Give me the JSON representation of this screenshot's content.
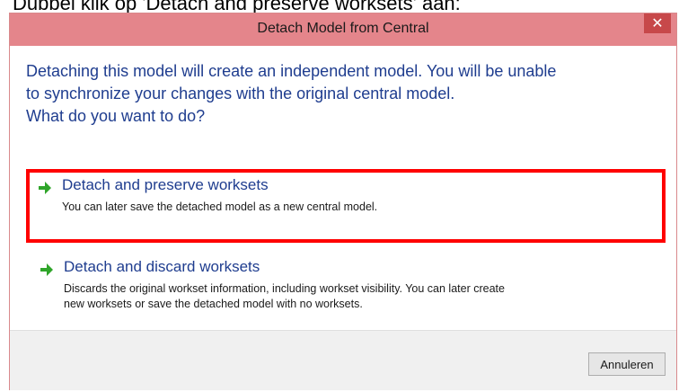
{
  "document": {
    "caption": "Dubbel klik op 'Detach and preserve worksets' aan:"
  },
  "dialog": {
    "title": "Detach Model from Central",
    "close_symbol": "✕",
    "message_lines": [
      "Detaching this model will create an independent model. You will be unable",
      "to synchronize your changes with the original central model.",
      "What do you want to do?"
    ],
    "options": [
      {
        "icon": "green-arrow-icon",
        "title": "Detach and preserve worksets",
        "description_lines": [
          "You can later save the detached model as a new central model."
        ],
        "highlighted": true
      },
      {
        "icon": "green-arrow-icon",
        "title": "Detach and discard worksets",
        "description_lines": [
          "Discards the original workset information, including workset visibility. You can later create",
          "new worksets or save the detached model with no worksets."
        ],
        "highlighted": false
      }
    ],
    "cancel_label": "Annuleren"
  },
  "colors": {
    "titlebar": "#e4858b",
    "close_button": "#c7484a",
    "accent_text": "#1f3d8f",
    "highlight_border": "#ff0000",
    "arrow_green": "#2fa52a"
  }
}
